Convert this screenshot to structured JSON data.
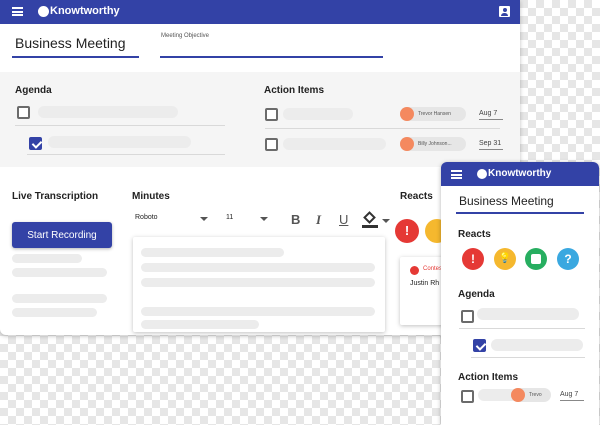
{
  "app": {
    "name": "Knowtworthy"
  },
  "meeting": {
    "title": "Business Meeting",
    "objective_placeholder": "Meeting Objective"
  },
  "sections": {
    "agenda": "Agenda",
    "action_items": "Action Items",
    "live_transcription": "Live Transcription",
    "minutes": "Minutes",
    "reacts": "Reacts"
  },
  "action_items": [
    {
      "assignee": "Trevor Hansen",
      "date": "Aug 7"
    },
    {
      "assignee": "Billy Johnson...",
      "date": "Sep 31"
    }
  ],
  "transcription": {
    "button_label": "Start Recording"
  },
  "editor": {
    "font": "Roboto",
    "size": "11",
    "bold": "B",
    "italic": "I",
    "underline": "U"
  },
  "react_card": {
    "tag": "Contes",
    "name": "Justin Rh"
  },
  "react_icons": [
    {
      "name": "exclamation-icon",
      "glyph": "!",
      "color": "#e53935"
    },
    {
      "name": "lightbulb-icon",
      "glyph": "💡",
      "color": "#f5b82e"
    },
    {
      "name": "plus-box-icon",
      "glyph": "+",
      "color": "#27ae60"
    },
    {
      "name": "question-icon",
      "glyph": "?",
      "color": "#3aa8e0"
    }
  ],
  "mobile": {
    "app_name": "Knowtworthy",
    "title": "Business Meeting",
    "reacts": "Reacts",
    "agenda": "Agenda",
    "action_items": "Action Items",
    "assignee": "Trevo",
    "date": "Aug 7"
  },
  "colors": {
    "brand": "#3342a6",
    "accent_orange": "#f4895f"
  }
}
